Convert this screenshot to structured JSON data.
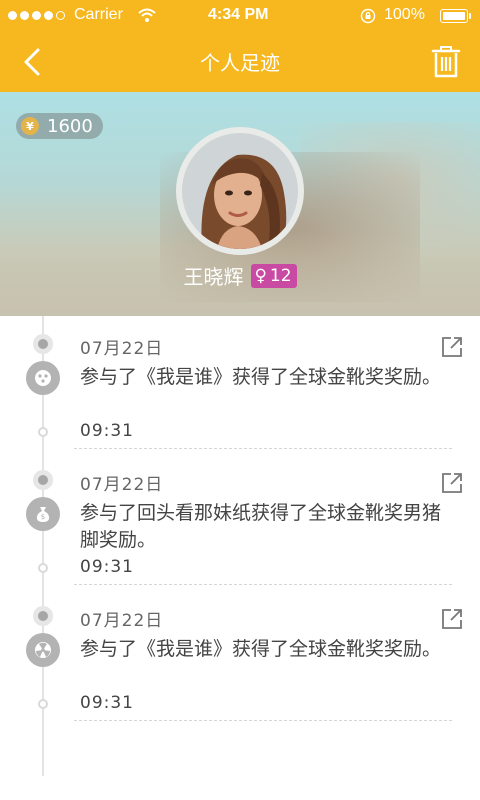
{
  "status_bar": {
    "carrier": "Carrier",
    "time": "4:34 PM",
    "battery": "100%"
  },
  "nav": {
    "title": "个人足迹",
    "back_icon": "chevron-left-icon",
    "trash_icon": "trash-icon"
  },
  "profile": {
    "coins": "1600",
    "coin_symbol": "¥",
    "name": "王晓辉",
    "gender_symbol": "♀",
    "level": "12"
  },
  "timeline": [
    {
      "date": "07月22日",
      "text": "参与了《我是谁》获得了全球金靴奖奖励。",
      "time": "09:31",
      "icon": "activity-icon"
    },
    {
      "date": "07月22日",
      "text": "参与了回头看那妹纸获得了全球金靴奖男猪脚奖励。",
      "time": "09:31",
      "icon": "money-bag-icon"
    },
    {
      "date": "07月22日",
      "text": "参与了《我是谁》获得了全球金靴奖奖励。",
      "time": "09:31",
      "icon": "radiation-icon"
    }
  ],
  "colors": {
    "accent": "#f6b81e",
    "badge": "#c94aa3"
  }
}
